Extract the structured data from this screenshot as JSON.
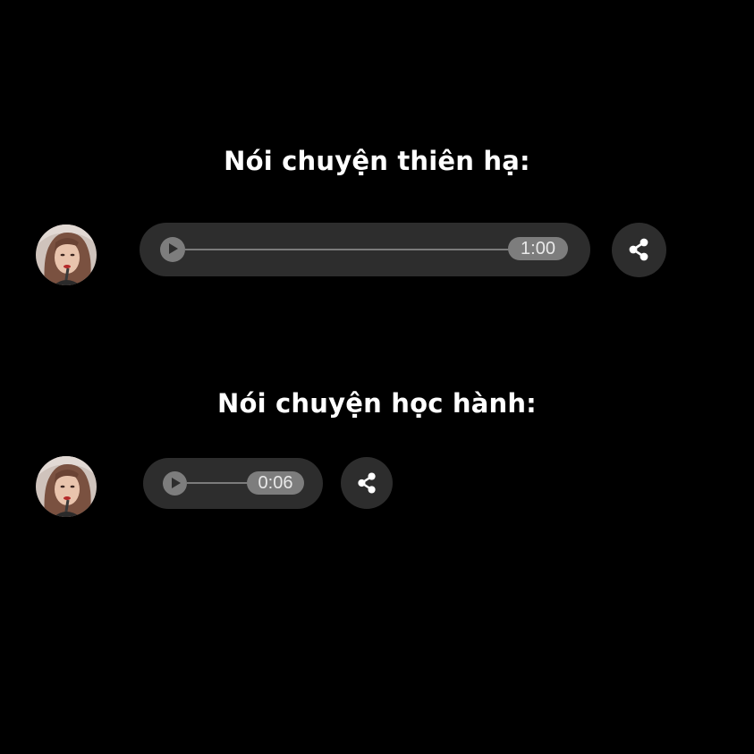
{
  "colors": {
    "background": "#000000",
    "bubble": "#2d2d2d",
    "control_gray": "#7d7d7d",
    "text": "#ffffff"
  },
  "messages": [
    {
      "caption": "Nói chuyện thiên hạ:",
      "duration": "1:00",
      "play_icon": "play-icon",
      "share_icon": "share-icon"
    },
    {
      "caption": "Nói chuyện học hành:",
      "duration": "0:06",
      "play_icon": "play-icon",
      "share_icon": "share-icon"
    }
  ]
}
